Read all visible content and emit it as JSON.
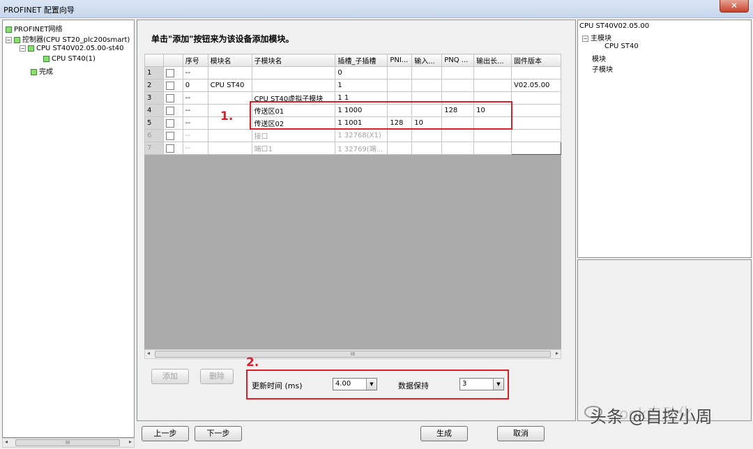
{
  "window": {
    "title": "PROFINET 配置向导",
    "close_glyph": "✕"
  },
  "left_tree": {
    "root": "PROFINET网络",
    "controller": "控制器(CPU ST20_plc200smart)",
    "device": "CPU ST40V02.05.00-st40",
    "module": "CPU ST40(1)",
    "done": "完成"
  },
  "scroll": {
    "grip": "III"
  },
  "instruction": "单击\"添加\"按钮来为该设备添加模块。",
  "grid": {
    "headers": [
      "",
      "",
      "序号",
      "模块名",
      "子模块名",
      "插槽_子插槽",
      "PNI...",
      "输入...",
      "PNQ ...",
      "输出长...",
      "固件版本"
    ],
    "rows": [
      {
        "n": "1",
        "seq": "--",
        "module": "",
        "submodule": "",
        "slot": "0",
        "pni": "",
        "in": "",
        "pnq": "",
        "out": "",
        "fw": "",
        "dim": false
      },
      {
        "n": "2",
        "seq": "0",
        "module": "CPU ST40",
        "submodule": "",
        "slot": "1",
        "pni": "",
        "in": "",
        "pnq": "",
        "out": "",
        "fw": "V02.05.00",
        "dim": false
      },
      {
        "n": "3",
        "seq": "--",
        "module": "",
        "submodule": "CPU ST40虚拟子模块",
        "slot": "1 1",
        "pni": "",
        "in": "",
        "pnq": "",
        "out": "",
        "fw": "",
        "dim": false
      },
      {
        "n": "4",
        "seq": "--",
        "module": "",
        "submodule": "传送区01",
        "slot": "1 1000",
        "pni": "",
        "in": "",
        "pnq": "128",
        "out": "10",
        "fw": "",
        "dim": false
      },
      {
        "n": "5",
        "seq": "--",
        "module": "",
        "submodule": "传送区02",
        "slot": "1 1001",
        "pni": "128",
        "in": "10",
        "pnq": "",
        "out": "",
        "fw": "",
        "dim": false
      },
      {
        "n": "6",
        "seq": "--",
        "module": "",
        "submodule": "接口",
        "slot": "1 32768(X1)",
        "pni": "",
        "in": "",
        "pnq": "",
        "out": "",
        "fw": "",
        "dim": true
      },
      {
        "n": "7",
        "seq": "--",
        "module": "",
        "submodule": "端口1",
        "slot": "1 32769(端...",
        "pni": "",
        "in": "",
        "pnq": "",
        "out": "",
        "fw": "",
        "dim": true
      }
    ]
  },
  "annotations": {
    "step1": "1.",
    "step2": "2."
  },
  "buttons": {
    "add": "添加",
    "delete": "删除",
    "prev": "上一步",
    "next": "下一步",
    "generate": "生成",
    "cancel": "取消"
  },
  "settings": {
    "update_time_label": "更新时间 (ms)",
    "update_time_value": "4.00",
    "data_hold_label": "数据保持",
    "data_hold_value": "3"
  },
  "right_tree": {
    "root": "CPU ST40V02.05.00",
    "main_module": "主模块",
    "cpu": "CPU ST40",
    "module": "模块",
    "submodule": "子模块"
  },
  "watermark": {
    "text": "头条 @自控小周",
    "bg_text": "ook自动化"
  },
  "colors": {
    "annotation_red": "#d9202a",
    "node_green": "#8fdc6e"
  }
}
